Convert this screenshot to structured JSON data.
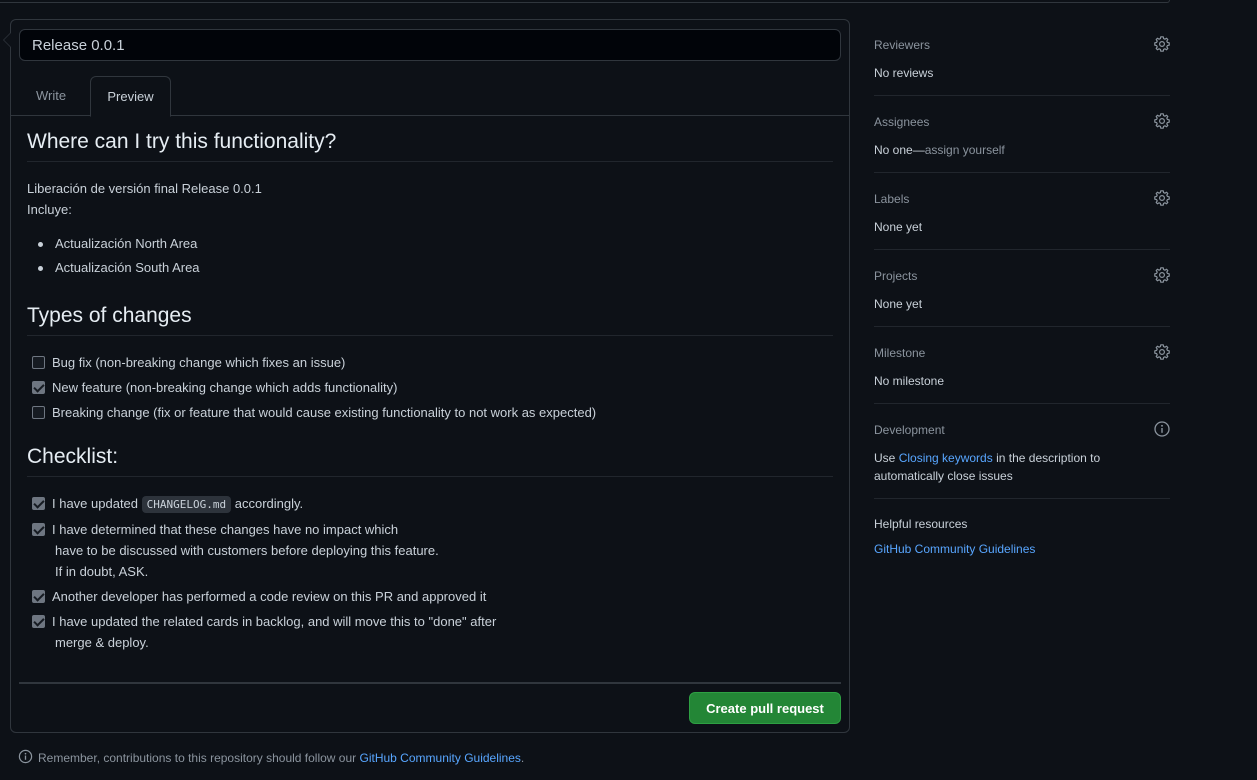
{
  "pr": {
    "title_value": "Release 0.0.1",
    "tabs": [
      "Write",
      "Preview"
    ],
    "preview": {
      "h_where": "Where can I try this functionality?",
      "intro_line1": "Liberación de versión final Release 0.0.1",
      "intro_line2": "Incluye:",
      "bullets": [
        "Actualización North Area",
        "Actualización South Area"
      ],
      "h_types": "Types of changes",
      "types": [
        {
          "text": "Bug fix (non-breaking change which fixes an issue)",
          "checked": false
        },
        {
          "text": "New feature (non-breaking change which adds functionality)",
          "checked": true
        },
        {
          "text": "Breaking change (fix or feature that would cause existing functionality to not work as expected)",
          "checked": false
        }
      ],
      "h_checklist": "Checklist:",
      "checklist": {
        "item1_pre": "I have updated",
        "item1_code": "CHANGELOG.md",
        "item1_post": "accordingly.",
        "item2_l1": "I have determined that these changes have no impact which",
        "item2_l2": "have to be discussed with customers before deploying this feature.",
        "item2_l3": "If in doubt, ASK.",
        "item3": "Another developer has performed a code review on this PR and approved it",
        "item4_l1": "I have updated the related cards in backlog, and will move this to \"done\" after",
        "item4_l2": "merge & deploy."
      }
    },
    "create_button": "Create pull request",
    "remember_text": "Remember, contributions to this repository should follow our",
    "remember_link": "GitHub Community Guidelines",
    "remember_tail": "."
  },
  "sidebar": {
    "reviewers": {
      "heading": "Reviewers",
      "value": "No reviews"
    },
    "assignees": {
      "heading": "Assignees",
      "value": "No one—",
      "link": "assign yourself"
    },
    "labels": {
      "heading": "Labels",
      "value": "None yet"
    },
    "projects": {
      "heading": "Projects",
      "value": "None yet"
    },
    "milestone": {
      "heading": "Milestone",
      "value": "No milestone"
    },
    "development": {
      "heading": "Development",
      "pre": "Use",
      "link": "Closing keywords",
      "post": "in the description to",
      "post2": "automatically close issues"
    },
    "helpful": {
      "heading": "Helpful resources",
      "link": "GitHub Community Guidelines"
    }
  },
  "colors": {
    "accent_link": "#58a6ff",
    "create_button_bg": "#238636",
    "background": "#0d1117"
  }
}
